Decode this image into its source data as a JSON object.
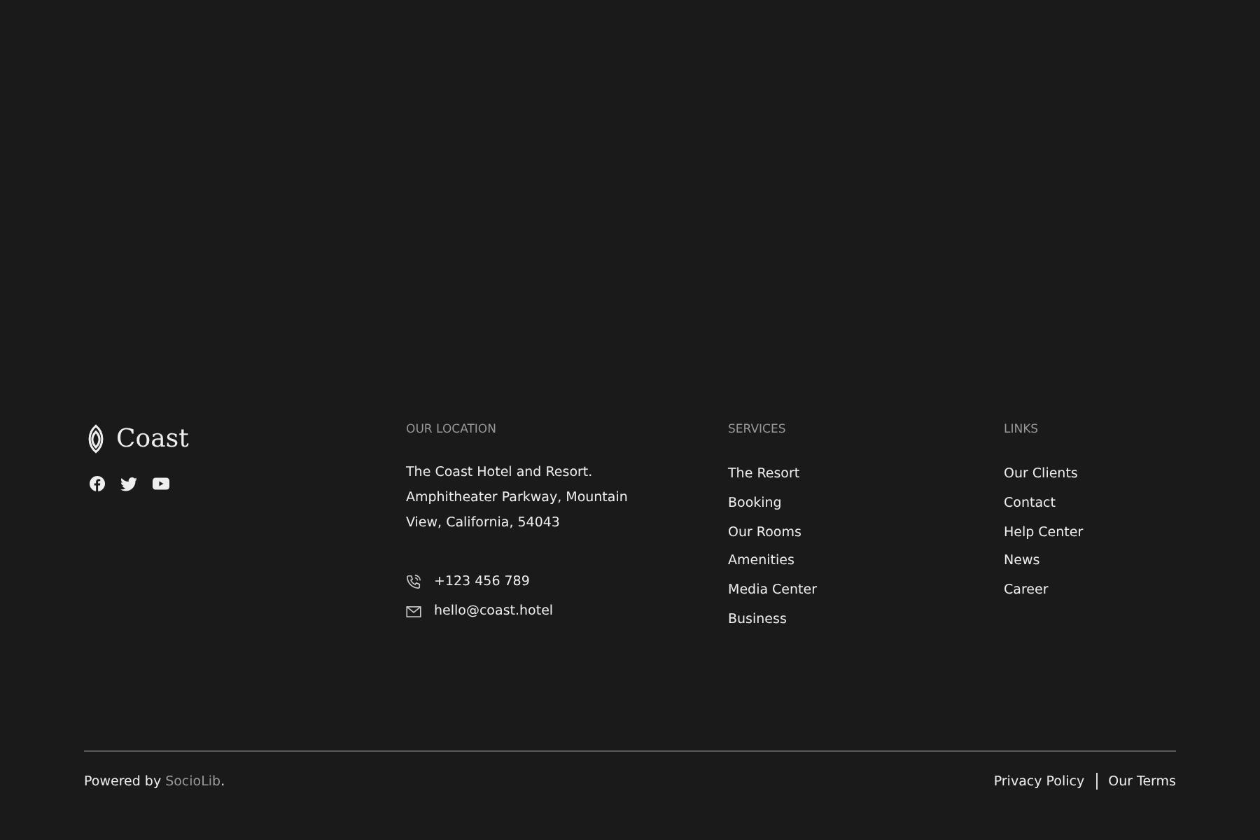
{
  "brand": {
    "name": "Coast"
  },
  "social": [
    {
      "kind": "facebook"
    },
    {
      "kind": "twitter"
    },
    {
      "kind": "youtube"
    }
  ],
  "location": {
    "heading": "OUR LOCATION",
    "address": [
      "The Coast Hotel and Resort.",
      "Amphitheater Parkway, Mountain",
      "View, California, 54043"
    ],
    "phone": "+123 456 789",
    "email": "hello@coast.hotel"
  },
  "services": {
    "heading": "SERVICES",
    "items": [
      "The Resort",
      "Booking",
      "Our Rooms",
      "Amenities",
      "Media Center",
      "Business"
    ]
  },
  "links": {
    "heading": "LINKS",
    "items": [
      "Our Clients",
      "Contact",
      "Help Center",
      "News",
      "Career"
    ]
  },
  "bottom": {
    "powered_prefix": "Powered by",
    "powered_link": "SocioLib",
    "powered_suffix": ".",
    "legal": [
      "Privacy Policy",
      "Our Terms"
    ]
  }
}
